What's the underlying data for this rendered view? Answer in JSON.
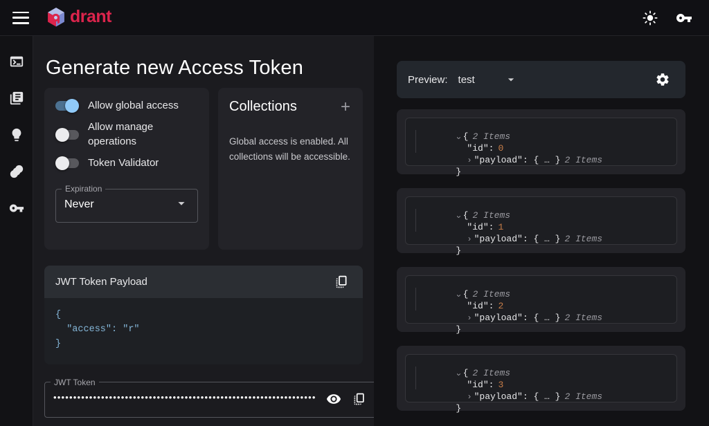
{
  "appbar": {
    "brand_text": "drant",
    "icons": {
      "menu": "hamburger-menu",
      "theme": "sun",
      "auth": "key"
    }
  },
  "sidebar": {
    "items": [
      {
        "label": "console",
        "icon": "terminal-icon"
      },
      {
        "label": "collections",
        "icon": "library-icon"
      },
      {
        "label": "tutorial",
        "icon": "lightbulb-icon"
      },
      {
        "label": "datasets",
        "icon": "datasets-icon"
      },
      {
        "label": "access-tokens",
        "icon": "key-icon"
      }
    ]
  },
  "main": {
    "title": "Generate new Access Token",
    "toggles": [
      {
        "label": "Allow global access",
        "on": true
      },
      {
        "label": "Allow manage operations",
        "on": false
      },
      {
        "label": "Token Validator",
        "on": false
      }
    ],
    "expiration": {
      "label": "Expiration",
      "value": "Never"
    },
    "collections_panel": {
      "title": "Collections",
      "add_label": "+",
      "message": "Global access is enabled. All collections will be accessible."
    },
    "payload_panel": {
      "title": "JWT Token Payload",
      "code_lines": [
        "{",
        "  \"access\": \"r\"",
        "}"
      ]
    },
    "token_field": {
      "label": "JWT Token",
      "masked_value": "••••••••••••••••••••••••••••••••••••••••••••••••••••••••••••••••••"
    }
  },
  "preview": {
    "label": "Preview:",
    "selected_collection": "test",
    "record_template": {
      "chevron": "›",
      "open_brace": "{",
      "close_brace": "}",
      "items_count": "2 Items",
      "id_key": "\"id\":",
      "payload_key": "\"payload\":",
      "payload_collapsed": "{ … }"
    },
    "records": [
      {
        "id": "0"
      },
      {
        "id": "1"
      },
      {
        "id": "2"
      },
      {
        "id": "3"
      }
    ]
  },
  "colors": {
    "brand_red": "#dc244c",
    "accent_blue": "#90caf9",
    "code_blue": "#85b7d9",
    "number_orange": "#c77d48"
  }
}
